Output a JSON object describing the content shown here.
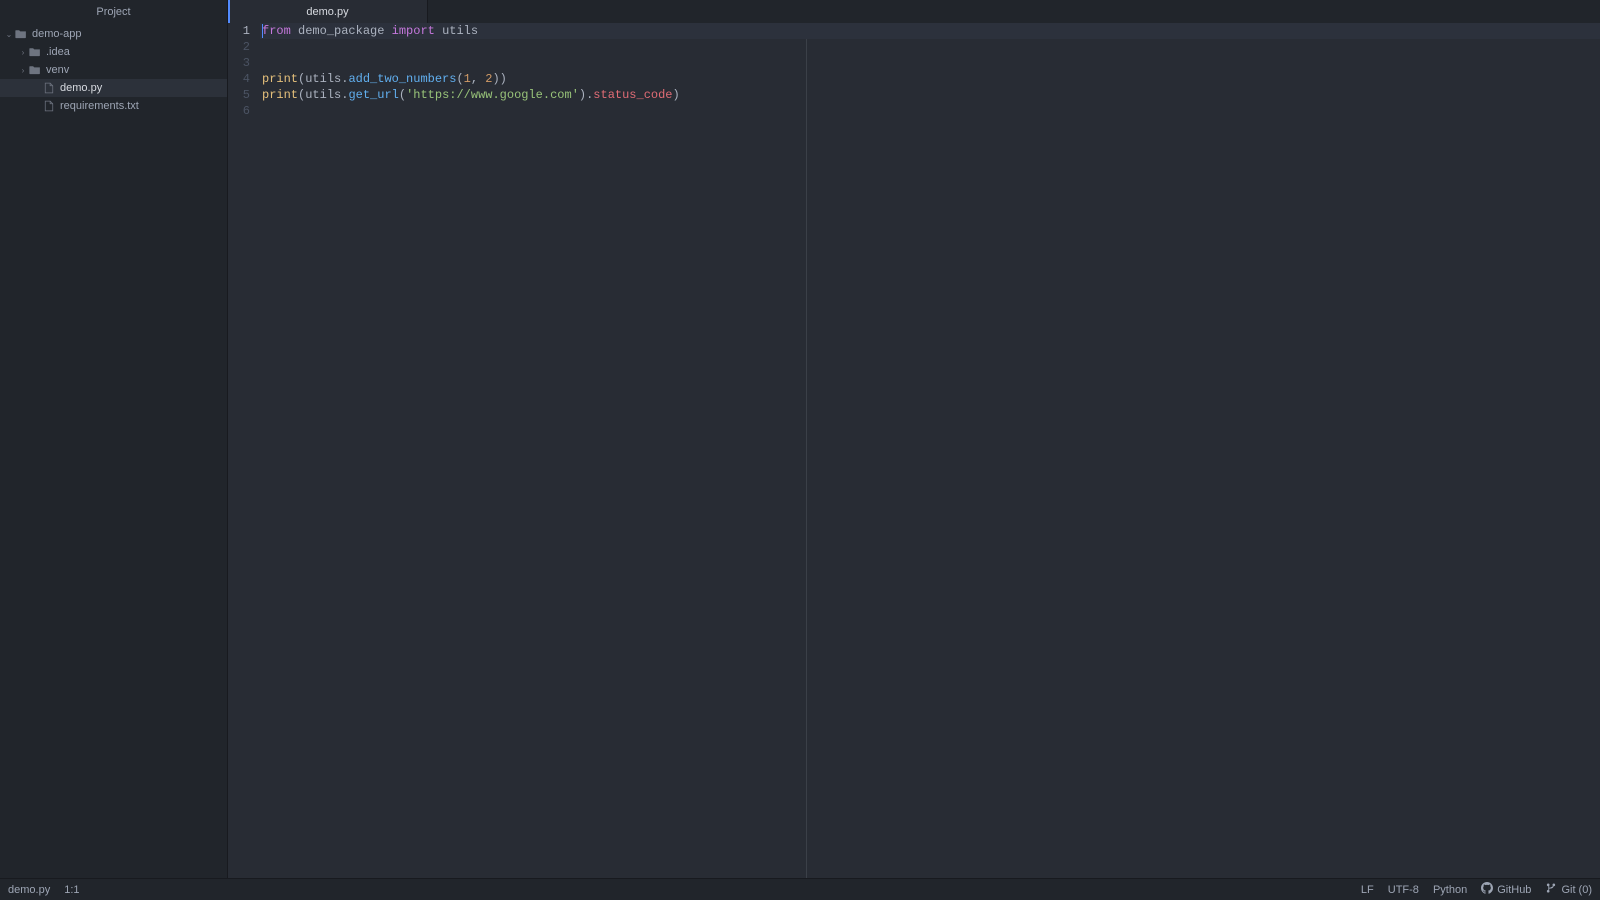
{
  "sidebar": {
    "title": "Project",
    "tree": [
      {
        "name": "demo-app",
        "type": "folder",
        "indent": 0,
        "expanded": true
      },
      {
        "name": ".idea",
        "type": "folder",
        "indent": 1,
        "expanded": false
      },
      {
        "name": "venv",
        "type": "folder",
        "indent": 1,
        "expanded": false
      },
      {
        "name": "demo.py",
        "type": "file",
        "indent": 2,
        "selected": true
      },
      {
        "name": "requirements.txt",
        "type": "file",
        "indent": 2
      }
    ]
  },
  "tabs": [
    {
      "label": "demo.py",
      "active": true
    }
  ],
  "editor": {
    "lines": [
      {
        "n": 1,
        "active": true,
        "tokens": [
          {
            "t": "from",
            "c": "kw"
          },
          {
            "t": " ",
            "c": "pl"
          },
          {
            "t": "demo_package",
            "c": "pl"
          },
          {
            "t": " ",
            "c": "pl"
          },
          {
            "t": "import",
            "c": "kw"
          },
          {
            "t": " ",
            "c": "pl"
          },
          {
            "t": "utils",
            "c": "pl"
          }
        ]
      },
      {
        "n": 2,
        "tokens": []
      },
      {
        "n": 3,
        "tokens": []
      },
      {
        "n": 4,
        "tokens": [
          {
            "t": "print",
            "c": "builtin"
          },
          {
            "t": "(",
            "c": "pl"
          },
          {
            "t": "utils",
            "c": "pl"
          },
          {
            "t": ".",
            "c": "pl"
          },
          {
            "t": "add_two_numbers",
            "c": "method"
          },
          {
            "t": "(",
            "c": "pl"
          },
          {
            "t": "1",
            "c": "num"
          },
          {
            "t": ", ",
            "c": "pl"
          },
          {
            "t": "2",
            "c": "num"
          },
          {
            "t": "))",
            "c": "pl"
          }
        ]
      },
      {
        "n": 5,
        "tokens": [
          {
            "t": "print",
            "c": "builtin"
          },
          {
            "t": "(",
            "c": "pl"
          },
          {
            "t": "utils",
            "c": "pl"
          },
          {
            "t": ".",
            "c": "pl"
          },
          {
            "t": "get_url",
            "c": "method"
          },
          {
            "t": "(",
            "c": "pl"
          },
          {
            "t": "'https://www.google.com'",
            "c": "str"
          },
          {
            "t": ").",
            "c": "pl"
          },
          {
            "t": "status_code",
            "c": "attr"
          },
          {
            "t": ")",
            "c": "pl"
          }
        ]
      },
      {
        "n": 6,
        "tokens": []
      }
    ]
  },
  "status": {
    "file": "demo.py",
    "cursor": "1:1",
    "eol": "LF",
    "encoding": "UTF-8",
    "language": "Python",
    "github": "GitHub",
    "git": "Git (0)"
  }
}
